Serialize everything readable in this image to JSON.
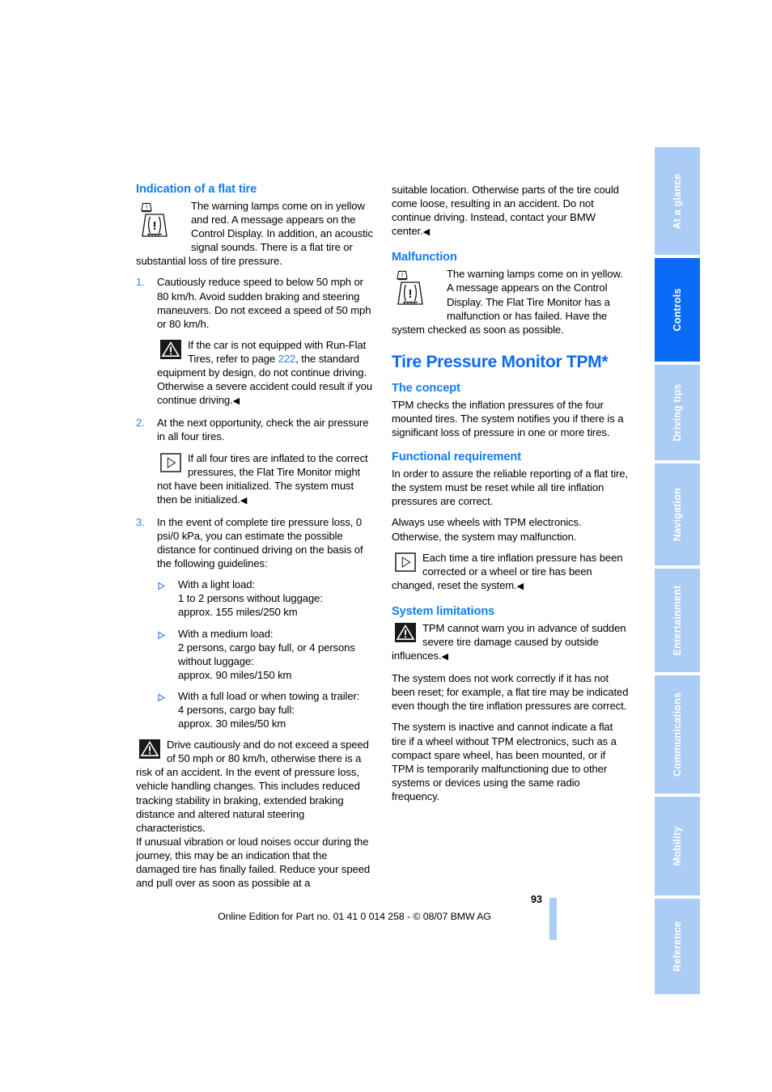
{
  "page": {
    "number": "93",
    "footer": "Online Edition for Part no. 01 41 0 014 258 - © 08/07 BMW AG"
  },
  "colors": {
    "heading_blue": "#0d7ef2",
    "chapter_blue": "#0a6cf5",
    "tab_inactive": "#aaccf5",
    "tab_active": "#0a6cf5",
    "link_blue": "#2f7fe8"
  },
  "sidebar": {
    "tabs": [
      {
        "label": "At a glance",
        "active": false
      },
      {
        "label": "Controls",
        "active": true
      },
      {
        "label": "Driving tips",
        "active": false
      },
      {
        "label": "Navigation",
        "active": false
      },
      {
        "label": "Entertainment",
        "active": false
      },
      {
        "label": "Communications",
        "active": false
      },
      {
        "label": "Mobility",
        "active": false
      },
      {
        "label": "Reference",
        "active": false
      }
    ]
  },
  "left_column": {
    "heading": "Indication of a flat tire",
    "intro": "The warning lamps come on in yellow and red. A message appears on the Control Display. In addition, an acoustic signal sounds. There is a flat tire or substantial loss of tire pressure.",
    "step1": {
      "num": "1.",
      "text": "Cautiously reduce speed to below 50 mph or 80 km/h. Avoid sudden braking and steering maneuvers. Do not exceed a speed of 50 mph or 80 km/h."
    },
    "warn1_a": "If the car is not equipped with Run-Flat Tires, refer to page ",
    "warn1_ref": "222",
    "warn1_b": ", the standard equipment by design, do not continue driving. Otherwise a severe accident could result if you continue driving.",
    "step2": {
      "num": "2.",
      "text": "At the next opportunity, check the air pressure in all four tires."
    },
    "note1": "If all four tires are inflated to the correct pressures, the Flat Tire Monitor might not have been initialized. The system must then be initialized.",
    "step3": {
      "num": "3.",
      "text": "In the event of complete tire pressure loss, 0 psi/0 kPa, you can estimate the possible distance for continued driving on the basis of the following guidelines:"
    },
    "loads": [
      "With a light load:\n1 to 2 persons without luggage:\napprox. 155 miles/250 km",
      "With a medium load:\n2 persons, cargo bay full, or 4 persons without luggage:\napprox. 90 miles/150 km",
      "With a full load or when towing a trailer:\n4 persons, cargo bay full:\napprox. 30 miles/50 km"
    ],
    "warn2": "Drive cautiously and do not exceed a speed of 50 mph or 80 km/h, otherwise there is a risk of an accident. In the event of pressure loss, vehicle handling changes. This includes reduced tracking stability in braking, extended braking distance and altered natural steering characteristics.",
    "warn2_cont": "If unusual vibration or loud noises occur during the journey, this may be an indication that the damaged tire has finally failed. Reduce your speed and pull over as soon as possible at a"
  },
  "right_column": {
    "continued": "suitable location. Otherwise parts of the tire could come loose, resulting in an accident. Do not continue driving. Instead, contact your BMW center.",
    "malfunction_heading": "Malfunction",
    "malfunction_text": "The warning lamps come on in yellow. A message appears on the Control Display. The Flat Tire Monitor has a malfunction or has failed. Have the system checked as soon as possible.",
    "chapter_title": "Tire Pressure Monitor TPM*",
    "concept_heading": "The concept",
    "concept_text": "TPM checks the inflation pressures of the four mounted tires. The system notifies you if there is a significant loss of pressure in one or more tires.",
    "functional_heading": "Functional requirement",
    "functional_p1": "In order to assure the reliable reporting of a flat tire, the system must be reset while all tire inflation pressures are correct.",
    "functional_p2": "Always use wheels with TPM electronics. Otherwise, the system may malfunction.",
    "functional_note": "Each time a tire inflation pressure has been corrected or a wheel or tire has been changed, reset the system.",
    "limitations_heading": "System limitations",
    "limitations_warn": "TPM cannot warn you in advance of sudden severe tire damage caused by outside influences.",
    "limitations_p1": "The system does not work correctly if it has not been reset; for example, a flat tire may be indicated even though the tire inflation pressures are correct.",
    "limitations_p2": "The system is inactive and cannot indicate a flat tire if a wheel without TPM electronics, such as a compact spare wheel, has been mounted, or if TPM is temporarily malfunctioning due to other systems or devices using the same radio frequency."
  },
  "icons": {
    "tire_warning": "tire-pressure-warning-icon",
    "caution": "caution-triangle-icon",
    "note": "note-arrow-icon",
    "end_mark": "◀"
  }
}
